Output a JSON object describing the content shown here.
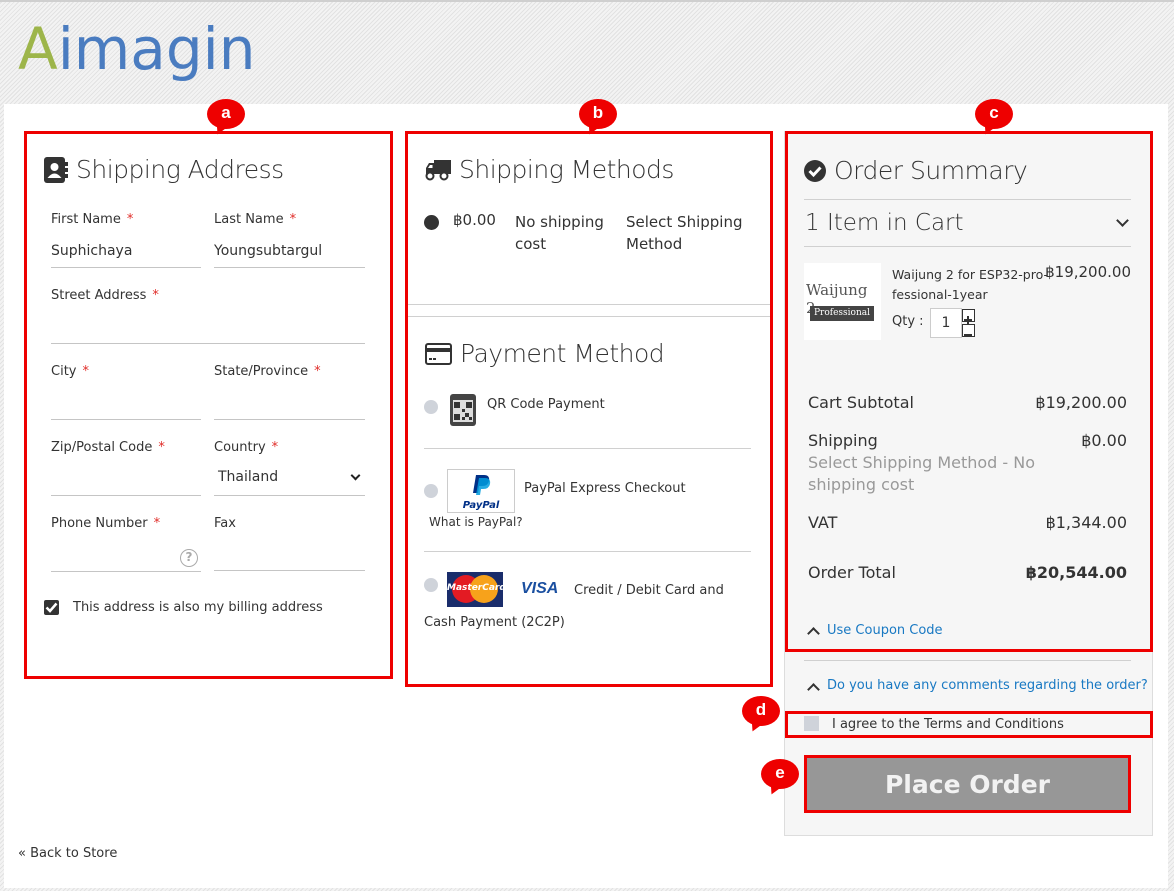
{
  "header": {
    "logo_first": "A",
    "logo_rest": "imagin"
  },
  "annotations": [
    "a",
    "b",
    "c",
    "d",
    "e"
  ],
  "shipping_address": {
    "title": "Shipping Address",
    "icon": "address-book-icon",
    "fields": {
      "first_name": {
        "label": "First Name",
        "required": "*",
        "value": "Suphichaya"
      },
      "last_name": {
        "label": "Last Name",
        "required": "*",
        "value": "Youngsubtargul"
      },
      "street": {
        "label": "Street Address",
        "required": "*",
        "value": ""
      },
      "city": {
        "label": "City",
        "required": "*",
        "value": ""
      },
      "state": {
        "label": "State/Province",
        "required": "*",
        "value": ""
      },
      "zip": {
        "label": "Zip/Postal Code",
        "required": "*",
        "value": ""
      },
      "country": {
        "label": "Country",
        "required": "*",
        "value": "Thailand"
      },
      "phone": {
        "label": "Phone Number",
        "required": "*",
        "value": "",
        "help_icon": "?"
      },
      "fax": {
        "label": "Fax",
        "value": ""
      }
    },
    "billing_checkbox": {
      "label": "This address is also my billing address",
      "checked": true
    }
  },
  "shipping_methods": {
    "title": "Shipping Methods",
    "icon": "truck-icon",
    "options": [
      {
        "price": "฿0.00",
        "method": "No shipping cost",
        "carrier": "Select Shipping Method",
        "selected": true
      }
    ]
  },
  "payment_method": {
    "title": "Payment Method",
    "icon": "credit-card-icon",
    "options": [
      {
        "label": "QR Code Payment",
        "logo": "qr-code-icon"
      },
      {
        "label": "PayPal Express Checkout",
        "logo": "paypal-logo",
        "logo_text": "PayPal",
        "sub_link": "What is PayPal?"
      },
      {
        "label": "Credit / Debit Card and Cash Payment (2C2P)",
        "logo": "mastercard-visa-logo",
        "mastercard_text": "MasterCard",
        "visa_text": "VISA"
      }
    ]
  },
  "order_summary": {
    "title": "Order Summary",
    "icon": "check-circle-icon",
    "items_in_cart": "1 Item in Cart",
    "items": [
      {
        "name": "Waijung 2 for ESP32-pro-fessional-1year",
        "name_line1": "Waijung 2 for ESP32-pro-",
        "name_line2": "fessional-1year",
        "price": "฿19,200.00",
        "thumb_title": "Waijung 2",
        "thumb_badge": "Professional",
        "qty_label": "Qty :",
        "qty": "1"
      }
    ],
    "totals": {
      "subtotal_label": "Cart Subtotal",
      "subtotal": "฿19,200.00",
      "shipping_label": "Shipping",
      "shipping_desc": "Select Shipping Method - No shipping cost",
      "shipping_desc_line1": "Select Shipping Method - No",
      "shipping_desc_line2": "shipping cost",
      "shipping": "฿0.00",
      "vat_label": "VAT",
      "vat": "฿1,344.00",
      "total_label": "Order Total",
      "total": "฿20,544.00"
    },
    "coupon_link": "Use Coupon Code",
    "comments_link": "Do you have any comments regarding the order?",
    "terms": {
      "label": "I agree to the Terms and Conditions",
      "checked": false
    },
    "place_order": "Place Order"
  },
  "footer": {
    "back_link": "« Back to Store"
  },
  "colors": {
    "annotation": "#ee0000",
    "link": "#1979c3",
    "place_order_bg": "#979797",
    "logo_a": "#9db54a",
    "logo_rest": "#4a7cc0"
  }
}
